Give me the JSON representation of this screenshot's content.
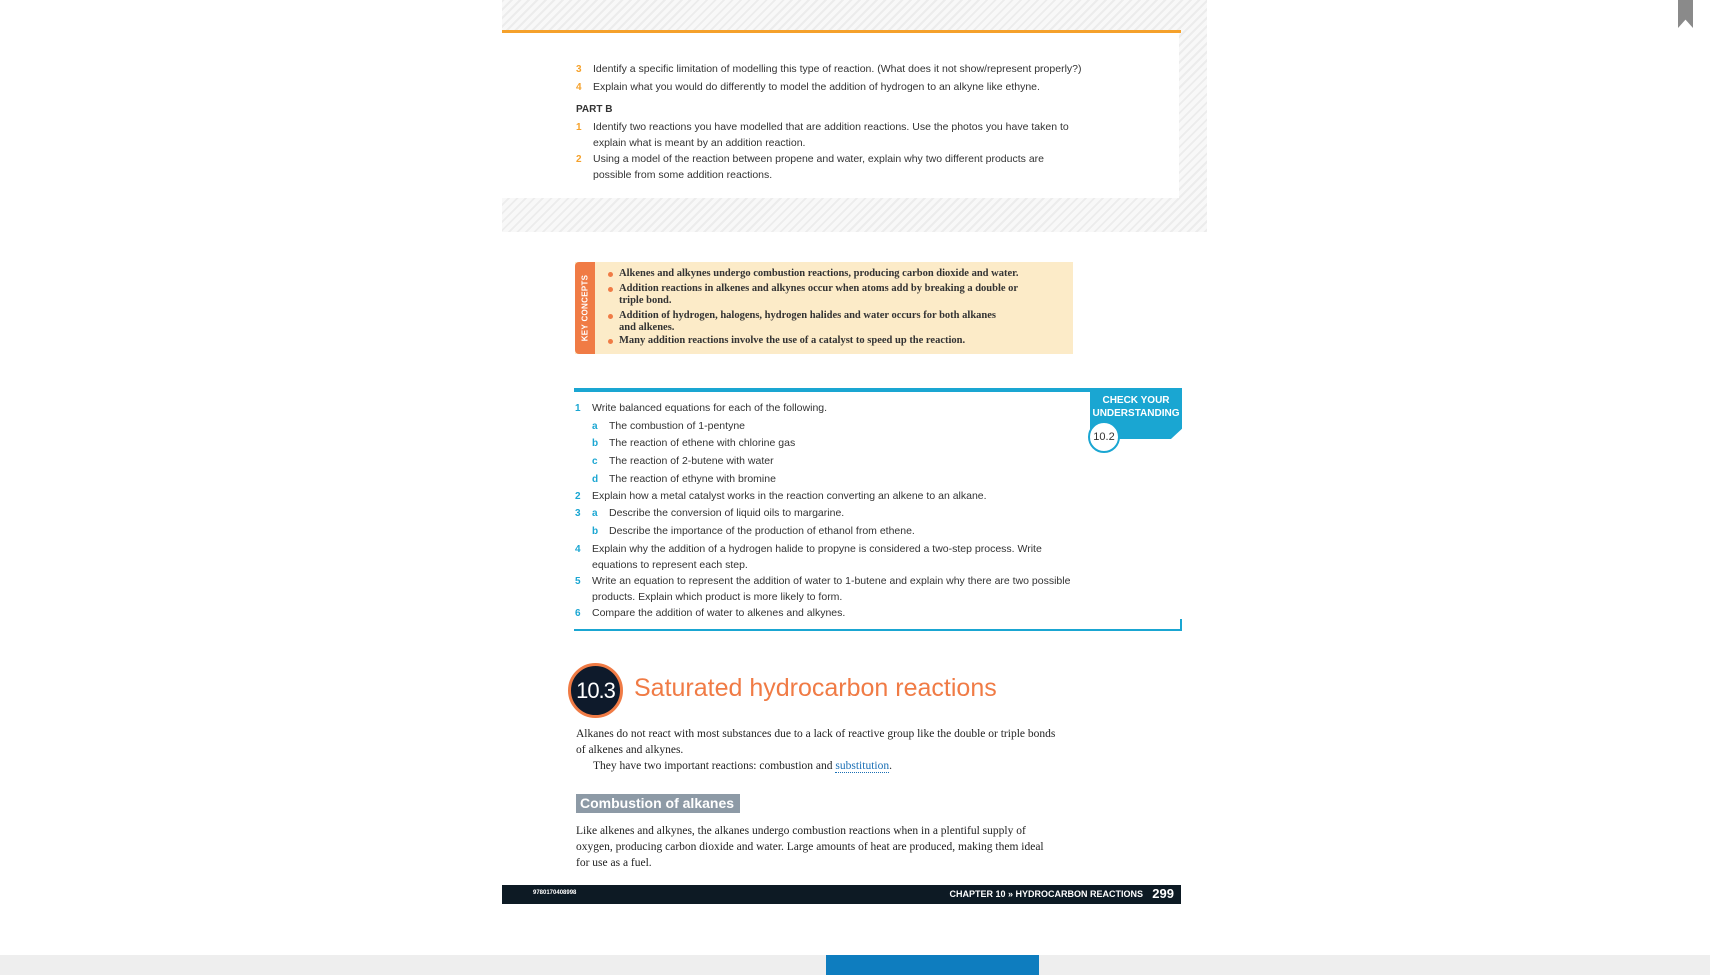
{
  "partA_questions": [
    {
      "num": "3",
      "text": "Identify a specific limitation of modelling this type of reaction. (What does it not show/represent properly?)"
    },
    {
      "num": "4",
      "text": "Explain what you would do differently to model the addition of hydrogen to an alkyne like ethyne."
    }
  ],
  "part_b_label": "PART B",
  "partB_questions": [
    {
      "num": "1",
      "line1": "Identify two reactions you have modelled that are addition reactions. Use the photos you have taken to",
      "line2": "explain what is meant by an addition reaction."
    },
    {
      "num": "2",
      "line1": "Using a model of the reaction between propene and water, explain why two different products are",
      "line2": "possible from some addition reactions."
    }
  ],
  "key_concepts": {
    "label": "KEY CONCEPTS",
    "items": [
      {
        "line1": "Alkenes and alkynes undergo combustion reactions, producing carbon dioxide and water."
      },
      {
        "line1": "Addition reactions in alkenes and alkynes occur when atoms add by breaking a double or",
        "line2": "triple bond."
      },
      {
        "line1": "Addition of hydrogen, halogens, hydrogen halides and water occurs for both alkanes",
        "line2": "and alkenes."
      },
      {
        "line1": "Many addition reactions involve the use of a catalyst to speed up the reaction."
      }
    ]
  },
  "check_understanding": {
    "title_line1": "CHECK YOUR",
    "title_line2": "UNDERSTANDING",
    "section": "10.2",
    "q1": {
      "num": "1",
      "text": "Write balanced equations for each of the following."
    },
    "q1_subs": [
      {
        "label": "a",
        "text": "The combustion of 1-pentyne"
      },
      {
        "label": "b",
        "text": "The reaction of ethene with chlorine gas"
      },
      {
        "label": "c",
        "text": "The reaction of 2-butene with water"
      },
      {
        "label": "d",
        "text": "The reaction of ethyne with bromine"
      }
    ],
    "q2": {
      "num": "2",
      "text": "Explain how a metal catalyst works in the reaction converting an alkene to an alkane."
    },
    "q3": {
      "num": "3",
      "sub_a_label": "a",
      "sub_a": "Describe the conversion of liquid oils to margarine.",
      "sub_b_label": "b",
      "sub_b": "Describe the importance of the production of ethanol from ethene."
    },
    "q4": {
      "num": "4",
      "line1": "Explain why the addition of a hydrogen halide to propyne is considered a two-step process. Write",
      "line2": "equations to represent each step."
    },
    "q5": {
      "num": "5",
      "line1": "Write an equation to represent the addition of water to 1-butene and explain why there are two possible",
      "line2": "products. Explain which product is more likely to form."
    },
    "q6": {
      "num": "6",
      "text": "Compare the addition of water to alkenes and alkynes."
    }
  },
  "section": {
    "number": "10.3",
    "title": "Saturated hydrocarbon reactions",
    "intro_line1": "Alkanes do not react with most substances due to a lack of reactive group like the double or triple bonds",
    "intro_line2": "of alkenes and alkynes.",
    "intro_line3_pre": "They have two important reactions: combustion and ",
    "intro_line3_link": "substitution",
    "intro_line3_post": ".",
    "subheading": "Combustion of alkanes",
    "para_line1": "Like alkenes and alkynes, the alkanes undergo combustion reactions when in a plentiful supply of",
    "para_line2": "oxygen, producing carbon dioxide and water. Large amounts of heat are produced, making them ideal",
    "para_line3": "for use as a fuel."
  },
  "footer": {
    "isbn": "9780170408998",
    "chapter": "CHAPTER 10 » HYDROCARBON REACTIONS",
    "page": "299"
  },
  "colors": {
    "orange": "#f07b45",
    "blue": "#1aa6d2",
    "amber": "#f5a12b",
    "navy": "#0d1a24"
  }
}
